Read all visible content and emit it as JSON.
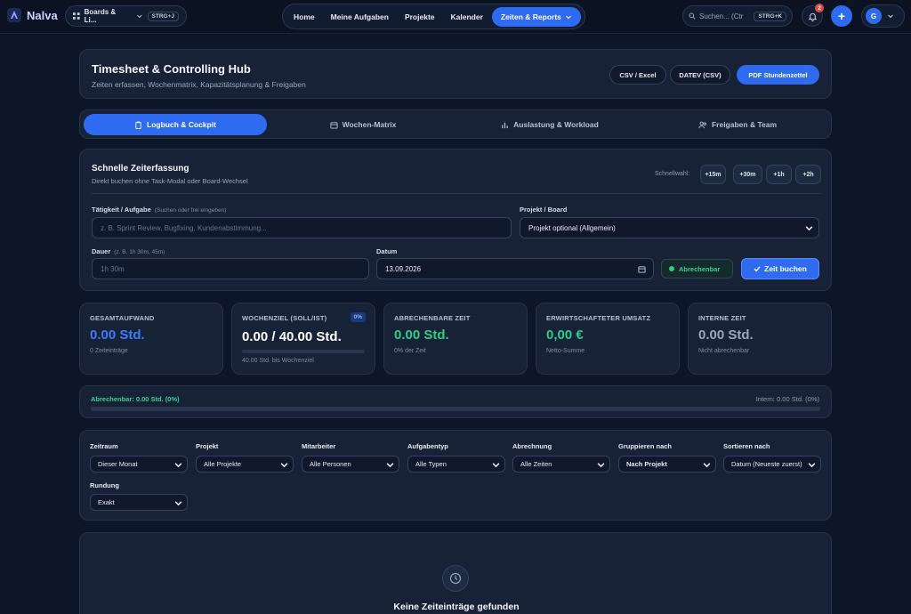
{
  "app": {
    "name": "Nalva"
  },
  "topbar": {
    "boards_label": "Boards & Li...",
    "boards_shortcut": "STRG+J",
    "nav": [
      "Home",
      "Meine Aufgaben",
      "Projekte",
      "Kalender",
      "Zeiten & Reports"
    ],
    "search_placeholder": "Suchen... (Ctr",
    "search_shortcut": "STRG+K",
    "notification_count": "2",
    "avatar_initial": "G"
  },
  "hub": {
    "title": "Timesheet & Controlling Hub",
    "subtitle": "Zeiten erfassen, Wochenmatrix, Kapazitätsplanung & Freigaben",
    "buttons": {
      "csv": "CSV / Excel",
      "datev": "DATEV (CSV)",
      "pdf": "PDF Stundenzettel"
    }
  },
  "tabs": [
    "Logbuch & Cockpit",
    "Wochen-Matrix",
    "Auslastung & Workload",
    "Freigaben & Team"
  ],
  "quick_entry": {
    "title": "Schnelle Zeiterfassung",
    "subtitle": "Direkt buchen ohne Task-Modal oder Board-Wechsel",
    "quick_select_label": "Schnellwahl:",
    "chips": [
      "+15m",
      "+30m",
      "+1h",
      "+2h"
    ],
    "task_label": "Tätigkeit / Aufgabe",
    "task_hint": "(Suchen oder frei eingeben)",
    "task_placeholder": "z. B. Sprint Review, Bugfixing, Kundenabstimmung...",
    "project_label": "Projekt / Board",
    "project_value": "Projekt optional (Allgemein)",
    "duration_label": "Dauer",
    "duration_hint": "(z. B. 1h 30m, 45m)",
    "duration_placeholder": "1h 30m",
    "date_label": "Datum",
    "date_value": "13.09.2026",
    "billable_label": "Abrechenbar",
    "book_label": "Zeit buchen"
  },
  "stats": [
    {
      "label": "GESAMTAUFWAND",
      "value": "0.00 Std.",
      "note": "0 Zeiteinträge",
      "color": "#3b7bff"
    },
    {
      "label": "WOCHENZIEL (SOLL/IST)",
      "value": "0.00 / 40.00 Std.",
      "note": "40.00 Std. bis Wochenziel",
      "badge": "0%",
      "color": "#ffffff",
      "progress": 0
    },
    {
      "label": "ABRECHENBARE ZEIT",
      "value": "0.00 Std.",
      "note": "0% der Zeit",
      "color": "#2ecc87"
    },
    {
      "label": "ERWIRTSCHAFTETER UMSATZ",
      "value": "0,00 €",
      "note": "Netto-Summe",
      "color": "#2ecc87"
    },
    {
      "label": "INTERNE ZEIT",
      "value": "0.00 Std.",
      "note": "Nicht abrechenbar",
      "color": "#9aa6bb"
    }
  ],
  "billable_bar": {
    "left": "Abrechenbar: 0.00 Std. (0%)",
    "right": "Intern: 0.00 Std. (0%)",
    "fraction": 0
  },
  "filters": [
    {
      "label": "Zeitraum",
      "value": "Dieser Monat"
    },
    {
      "label": "Projekt",
      "value": "Alle Projekte"
    },
    {
      "label": "Mitarbeiter",
      "value": "Alle Personen"
    },
    {
      "label": "Aufgabentyp",
      "value": "Alle Typen"
    },
    {
      "label": "Abrechnung",
      "value": "Alle Zeiten"
    },
    {
      "label": "Gruppieren nach",
      "value": "Nach Projekt"
    },
    {
      "label": "Sortieren nach",
      "value": "Datum (Neueste zuerst)"
    },
    {
      "label": "Rundung",
      "value": "Exakt"
    }
  ],
  "empty_state": {
    "text": "Keine Zeiteinträge gefunden"
  },
  "colors": {
    "accent": "#2f6bf1",
    "success": "#2ecc87",
    "background": "#0d1628",
    "panel": "#172236"
  }
}
